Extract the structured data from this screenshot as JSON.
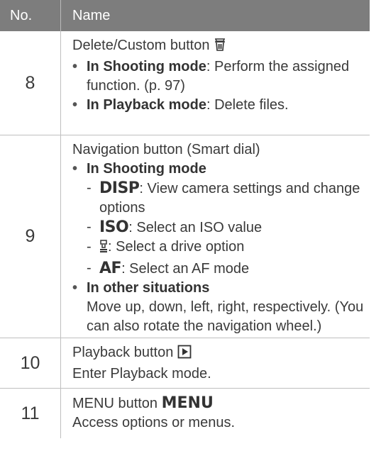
{
  "header": {
    "col_no": "No.",
    "col_name": "Name"
  },
  "rows": [
    {
      "no": "8",
      "title": "Delete/Custom button",
      "title_icon": "trash-icon",
      "bullets": [
        {
          "label": "In Shooting mode",
          "text": ": Perform the assigned function. (p. 97)"
        },
        {
          "label": "In Playback mode",
          "text": ": Delete files."
        }
      ]
    },
    {
      "no": "9",
      "title": "Navigation button (Smart dial)",
      "shooting_label": "In Shooting mode",
      "subitems": [
        {
          "icon_text": "DISP",
          "text": ": View camera settings and change options"
        },
        {
          "icon_text": "ISO",
          "text": ": Select an ISO value"
        },
        {
          "icon": "drive-mode-icon",
          "text": ": Select a drive option"
        },
        {
          "icon_text": "AF",
          "text": ": Select an AF mode"
        }
      ],
      "other_label": "In other situations",
      "other_text": "Move up, down, left, right, respectively. (You can also rotate the navigation wheel.)"
    },
    {
      "no": "10",
      "title": "Playback button",
      "title_icon": "playback-icon",
      "text": "Enter Playback mode."
    },
    {
      "no": "11",
      "title": "MENU button",
      "title_icon_text": "MENU",
      "text": "Access options or menus."
    }
  ]
}
